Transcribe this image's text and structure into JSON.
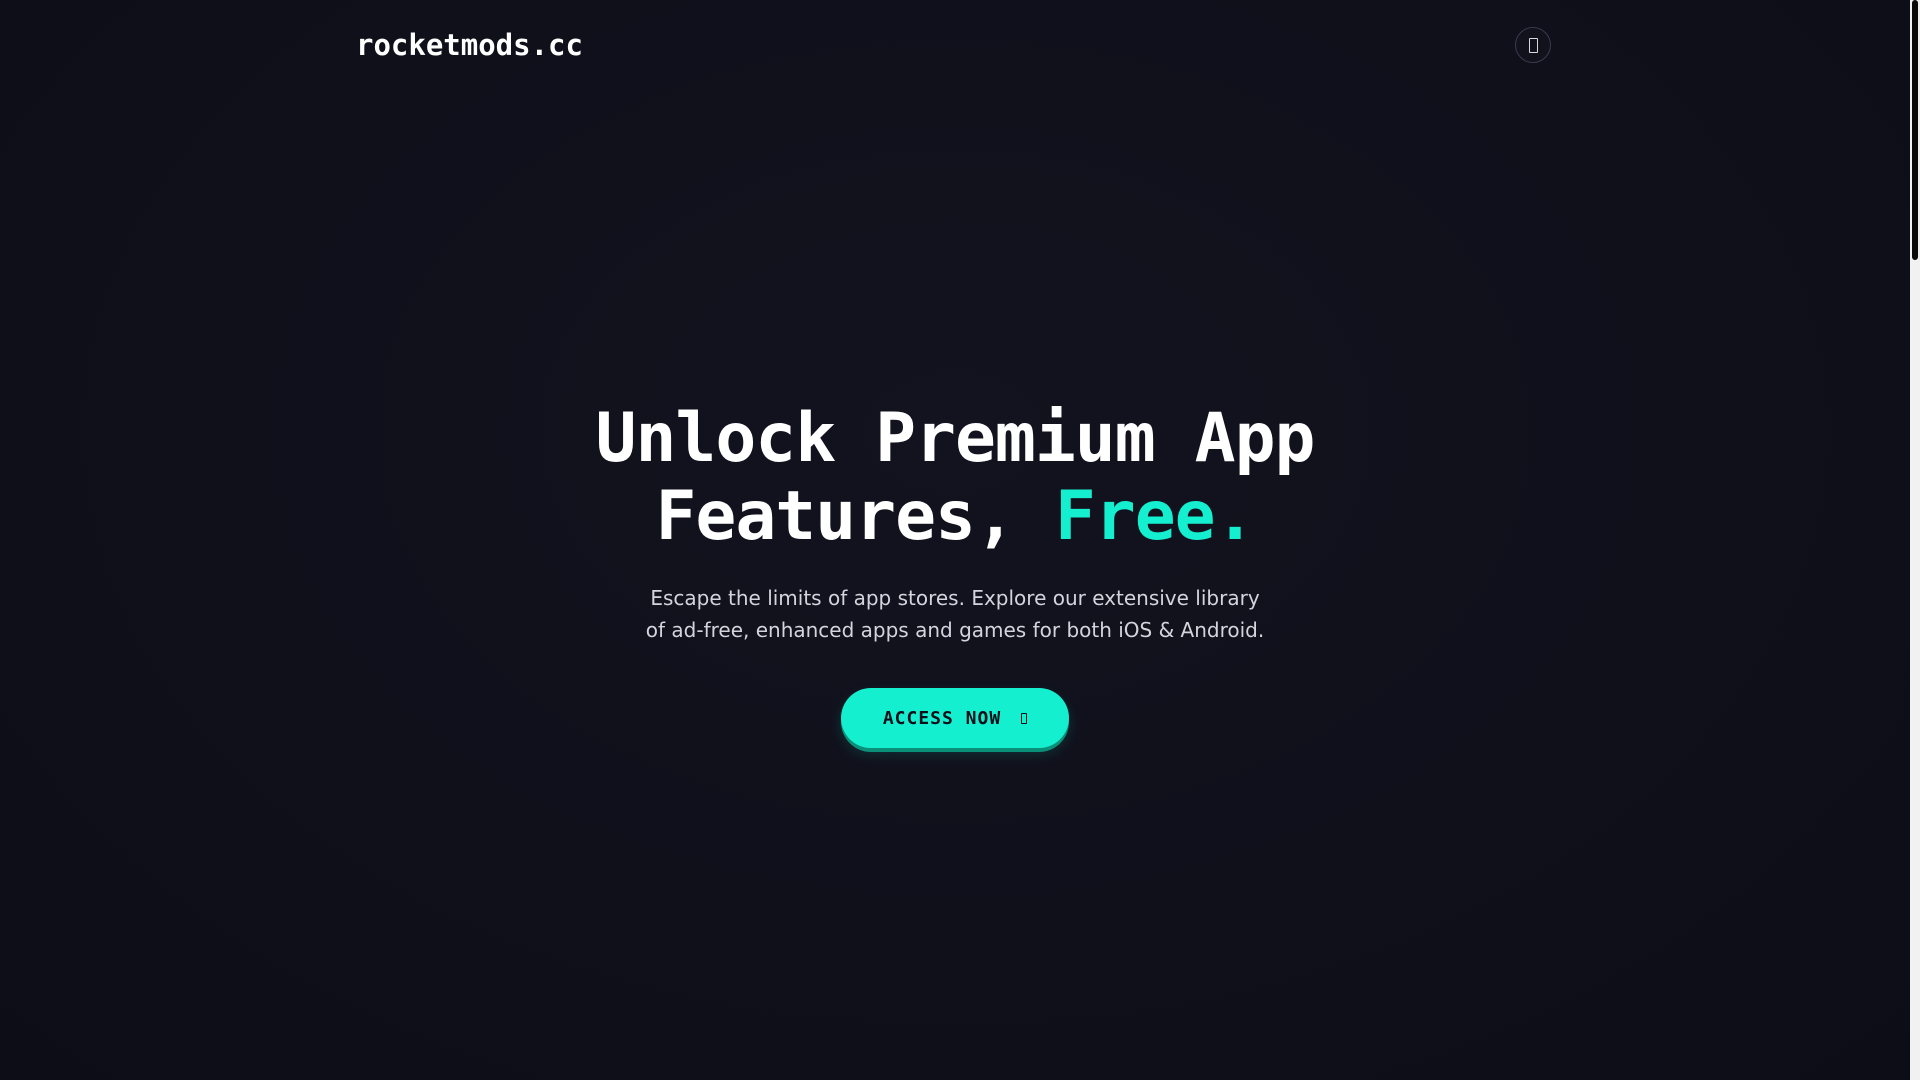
{
  "header": {
    "logo_text": "rocketmods.cc",
    "menu_icon": "menu-icon"
  },
  "hero": {
    "title_line1": "Unlock Premium App",
    "title_line2_white": "Features, ",
    "title_line2_accent": "Free.",
    "subtitle": "Escape the limits of app stores. Explore our extensive library of ad-free, enhanced apps and games for both iOS & Android.",
    "cta_label": "ACCESS NOW",
    "cta_icon": "arrow-icon"
  },
  "colors": {
    "background": "#0f0f1a",
    "accent": "#14f0cf",
    "text": "#ffffff",
    "muted_text": "#d4d4dc"
  }
}
